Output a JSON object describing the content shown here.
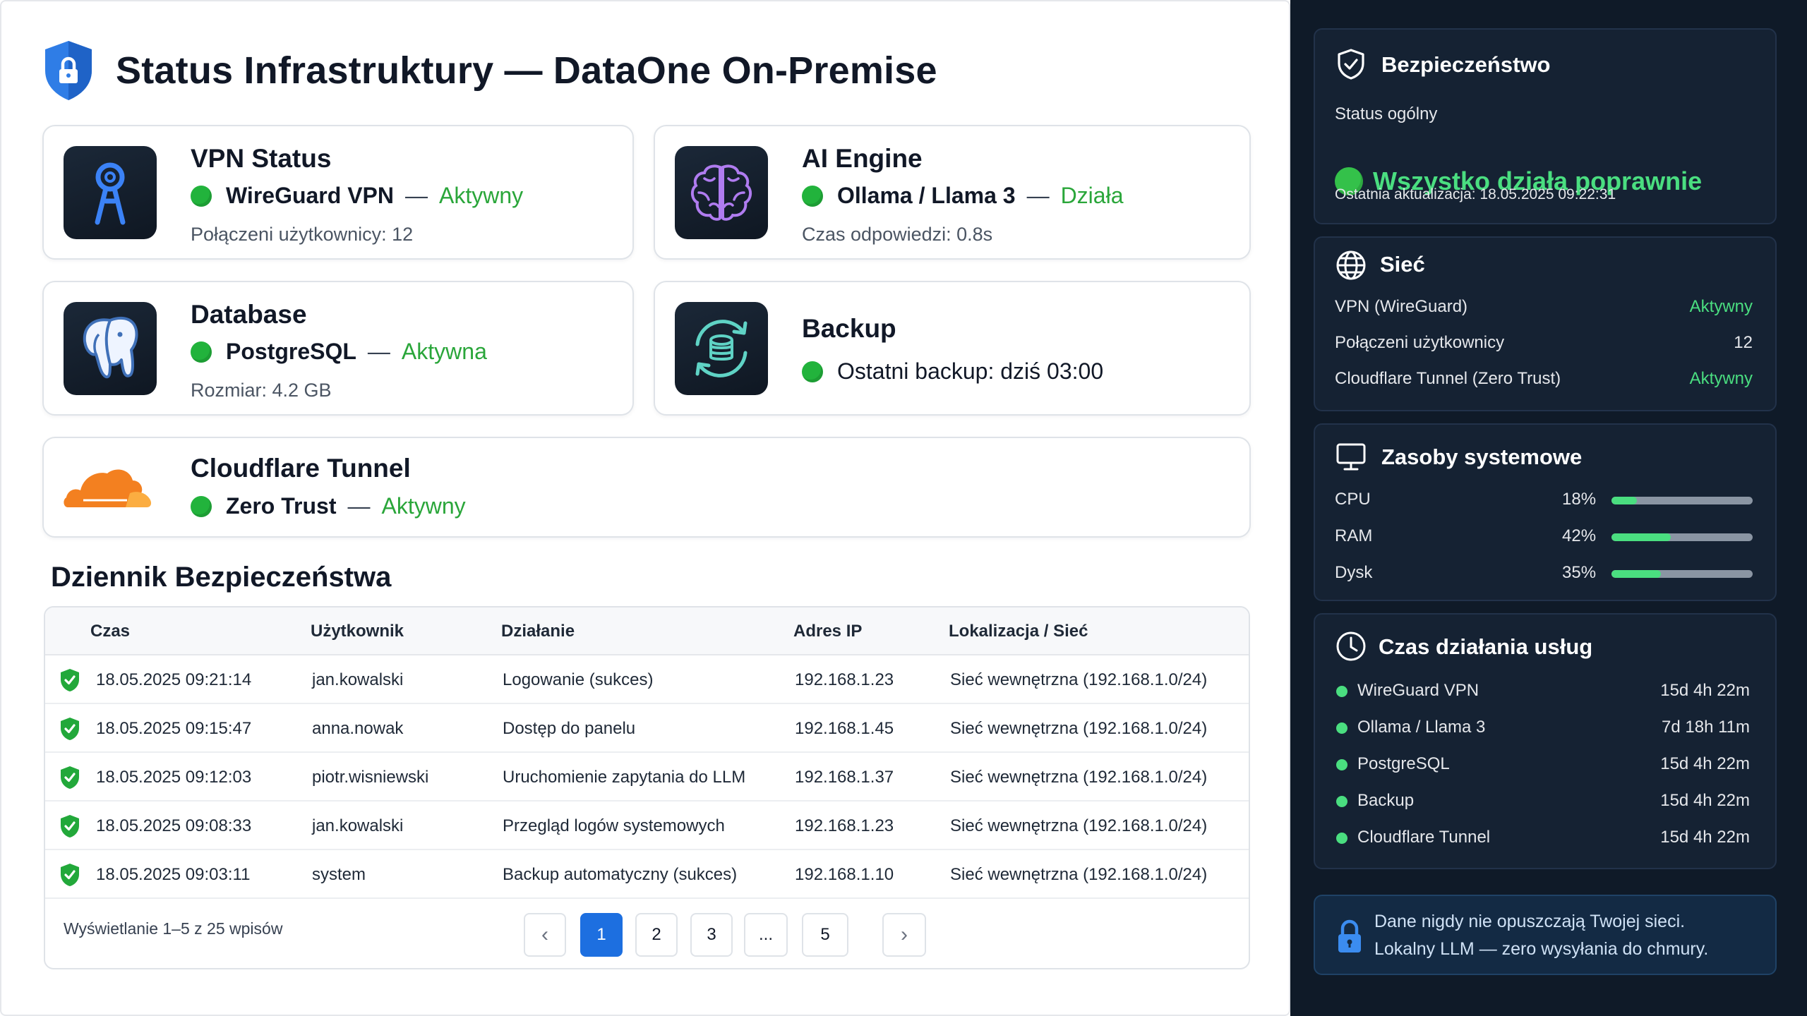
{
  "header": {
    "title": "Status Infrastruktury — DataOne On-Premise"
  },
  "cards": {
    "vpn": {
      "title": "VPN Status",
      "name": "WireGuard VPN",
      "status": "Aktywny",
      "sub": "Połączeni użytkownicy: 12",
      "icon": "vpn-key-icon"
    },
    "ai": {
      "title": "AI Engine",
      "name": "Ollama / Llama 3",
      "status": "Działa",
      "sub": "Czas odpowiedzi: 0.8s",
      "icon": "brain-icon"
    },
    "db": {
      "title": "Database",
      "name": "PostgreSQL",
      "status": "Aktywna",
      "sub": "Rozmiar: 4.2 GB",
      "icon": "postgresql-elephant-icon"
    },
    "backup": {
      "title": "Backup",
      "text": "Ostatni backup: dziś 03:00",
      "icon": "backup-sync-icon"
    },
    "cloudflare": {
      "title": "Cloudflare Tunnel",
      "name": "Zero Trust",
      "status": "Aktywny",
      "icon": "cloudflare-cloud-icon"
    }
  },
  "log": {
    "title": "Dziennik Bezpieczeństwa",
    "columns": [
      "Czas",
      "Użytkownik",
      "Działanie",
      "Adres IP",
      "Lokalizacja / Sieć"
    ],
    "rows": [
      [
        "18.05.2025 09:21:14",
        "jan.kowalski",
        "Logowanie (sukces)",
        "192.168.1.23",
        "Sieć wewnętrzna (192.168.1.0/24)"
      ],
      [
        "18.05.2025 09:15:47",
        "anna.nowak",
        "Dostęp do panelu",
        "192.168.1.45",
        "Sieć wewnętrzna (192.168.1.0/24)"
      ],
      [
        "18.05.2025 09:12:03",
        "piotr.wisniewski",
        "Uruchomienie zapytania do LLM",
        "192.168.1.37",
        "Sieć wewnętrzna (192.168.1.0/24)"
      ],
      [
        "18.05.2025 09:08:33",
        "jan.kowalski",
        "Przegląd logów systemowych",
        "192.168.1.23",
        "Sieć wewnętrzna (192.168.1.0/24)"
      ],
      [
        "18.05.2025 09:03:11",
        "system",
        "Backup automatyczny (sukces)",
        "192.168.1.10",
        "Sieć wewnętrzna (192.168.1.0/24)"
      ]
    ],
    "footer": "Wyświetlanie 1–5 z 25 wpisów",
    "pages": [
      "1",
      "2",
      "3",
      "...",
      "5"
    ],
    "current_page": "1"
  },
  "sidebar": {
    "security": {
      "title": "Bezpieczeństwo",
      "label": "Status ogólny",
      "status": "Wszystko działa poprawnie",
      "updated": "Ostatnia aktualizacja: 18.05.2025 09:22:31"
    },
    "network": {
      "title": "Sieć",
      "items": [
        {
          "label": "VPN (WireGuard)",
          "value": "Aktywny"
        },
        {
          "label": "Połączeni użytkownicy",
          "value": "12"
        },
        {
          "label": "Cloudflare Tunnel (Zero Trust)",
          "value": "Aktywny"
        }
      ]
    },
    "resources": {
      "title": "Zasoby systemowe",
      "items": [
        {
          "label": "CPU",
          "value": "18%",
          "fraction": 0.18
        },
        {
          "label": "RAM",
          "value": "42%",
          "fraction": 0.42
        },
        {
          "label": "Dysk",
          "value": "35%",
          "fraction": 0.35
        }
      ]
    },
    "uptime": {
      "title": "Czas działania usług",
      "items": [
        {
          "name": "WireGuard VPN",
          "time": "15d 4h 22m"
        },
        {
          "name": "Ollama / Llama 3",
          "time": "7d 18h 11m"
        },
        {
          "name": "PostgreSQL",
          "time": "15d 4h 22m"
        },
        {
          "name": "Backup",
          "time": "15d 4h 22m"
        },
        {
          "name": "Cloudflare Tunnel",
          "time": "15d 4h 22m"
        }
      ]
    },
    "info": {
      "line1": "Dane nigdy nie opuszczają Twojej sieci.",
      "line2": "Lokalny LLM — zero wysyłania do chmury."
    }
  },
  "colors": {
    "accent": "#1d6fe0",
    "status_green": "#22b33c",
    "sidebar_bg": "#0f1a28",
    "panel_bg": "#152233"
  }
}
